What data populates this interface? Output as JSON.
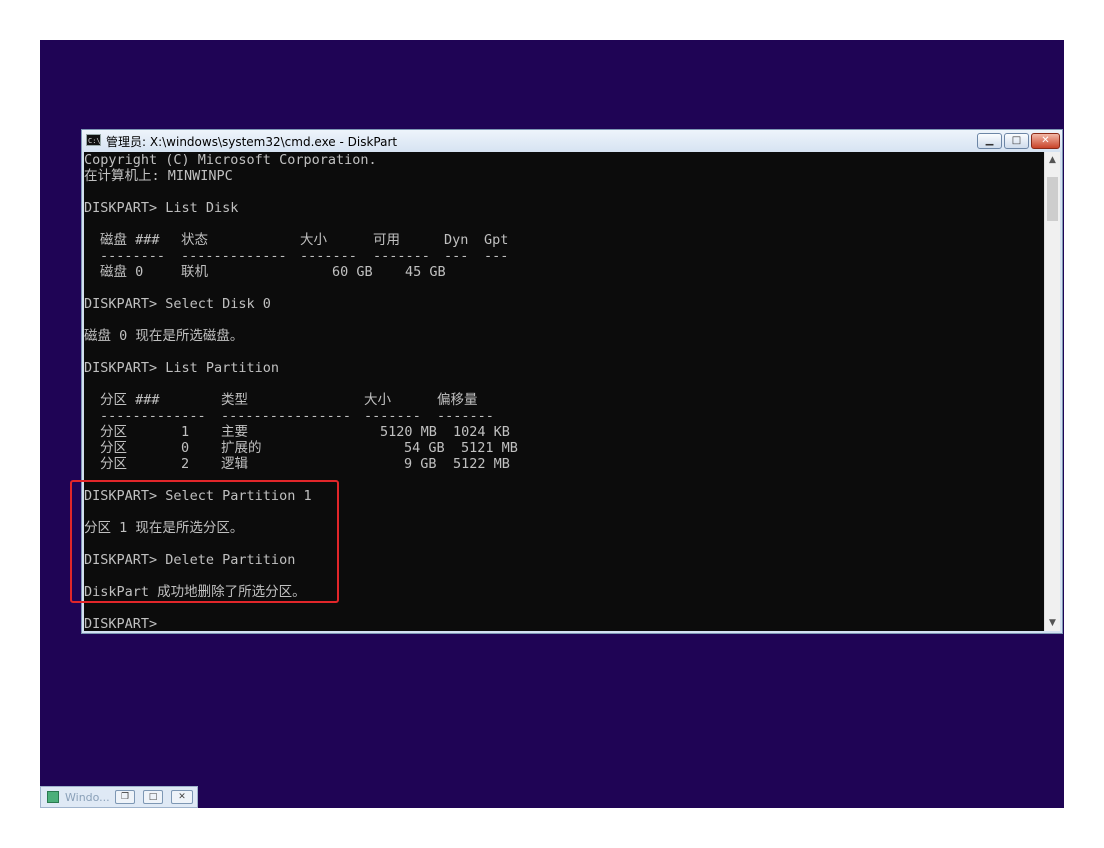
{
  "window": {
    "title": "管理员: X:\\windows\\system32\\cmd.exe - DiskPart",
    "min_label": "▁",
    "max_label": "□",
    "close_label": "✕"
  },
  "console": {
    "copyright": "Copyright (C) Microsoft Corporation.",
    "computer": "在计算机上: MINWINPC",
    "cmd_list_disk": "DISKPART> List Disk",
    "disk_table": {
      "headers": [
        "磁盘 ###",
        "状态",
        "大小",
        "可用",
        "Dyn",
        "Gpt"
      ],
      "separators": [
        "--------",
        "-------------",
        "-------",
        "-------",
        "---",
        "---"
      ],
      "rows": [
        [
          "磁盘 0",
          "联机",
          "60 GB",
          "45 GB",
          "",
          ""
        ]
      ]
    },
    "cmd_select_disk": "DISKPART> Select Disk 0",
    "msg_disk_selected": "磁盘 0 现在是所选磁盘。",
    "cmd_list_partition": "DISKPART> List Partition",
    "partition_table": {
      "headers": [
        "分区 ###",
        "类型",
        "大小",
        "偏移量"
      ],
      "separators": [
        "-------------",
        "----------------",
        "-------",
        "-------"
      ],
      "rows": [
        [
          "分区",
          "1",
          "主要",
          "5120 MB",
          "1024 KB"
        ],
        [
          "分区",
          "0",
          "扩展的",
          "54 GB",
          "5121 MB"
        ],
        [
          "分区",
          "2",
          "逻辑",
          "9 GB",
          "5122 MB"
        ]
      ]
    },
    "cmd_select_partition": "DISKPART> Select Partition 1",
    "msg_partition_selected": "分区 1 现在是所选分区。",
    "cmd_delete_partition": "DISKPART> Delete Partition",
    "msg_deleted": "DiskPart 成功地删除了所选分区。",
    "prompt": "DISKPART>"
  },
  "taskbar": {
    "label": "Windo...",
    "restore_label": "❐",
    "max_label": "□",
    "close_label": "✕"
  },
  "colors": {
    "desktop": "#1f0455",
    "console_bg": "#0c0c0c",
    "console_text": "#c0c0c0",
    "highlight": "#e2262a"
  }
}
